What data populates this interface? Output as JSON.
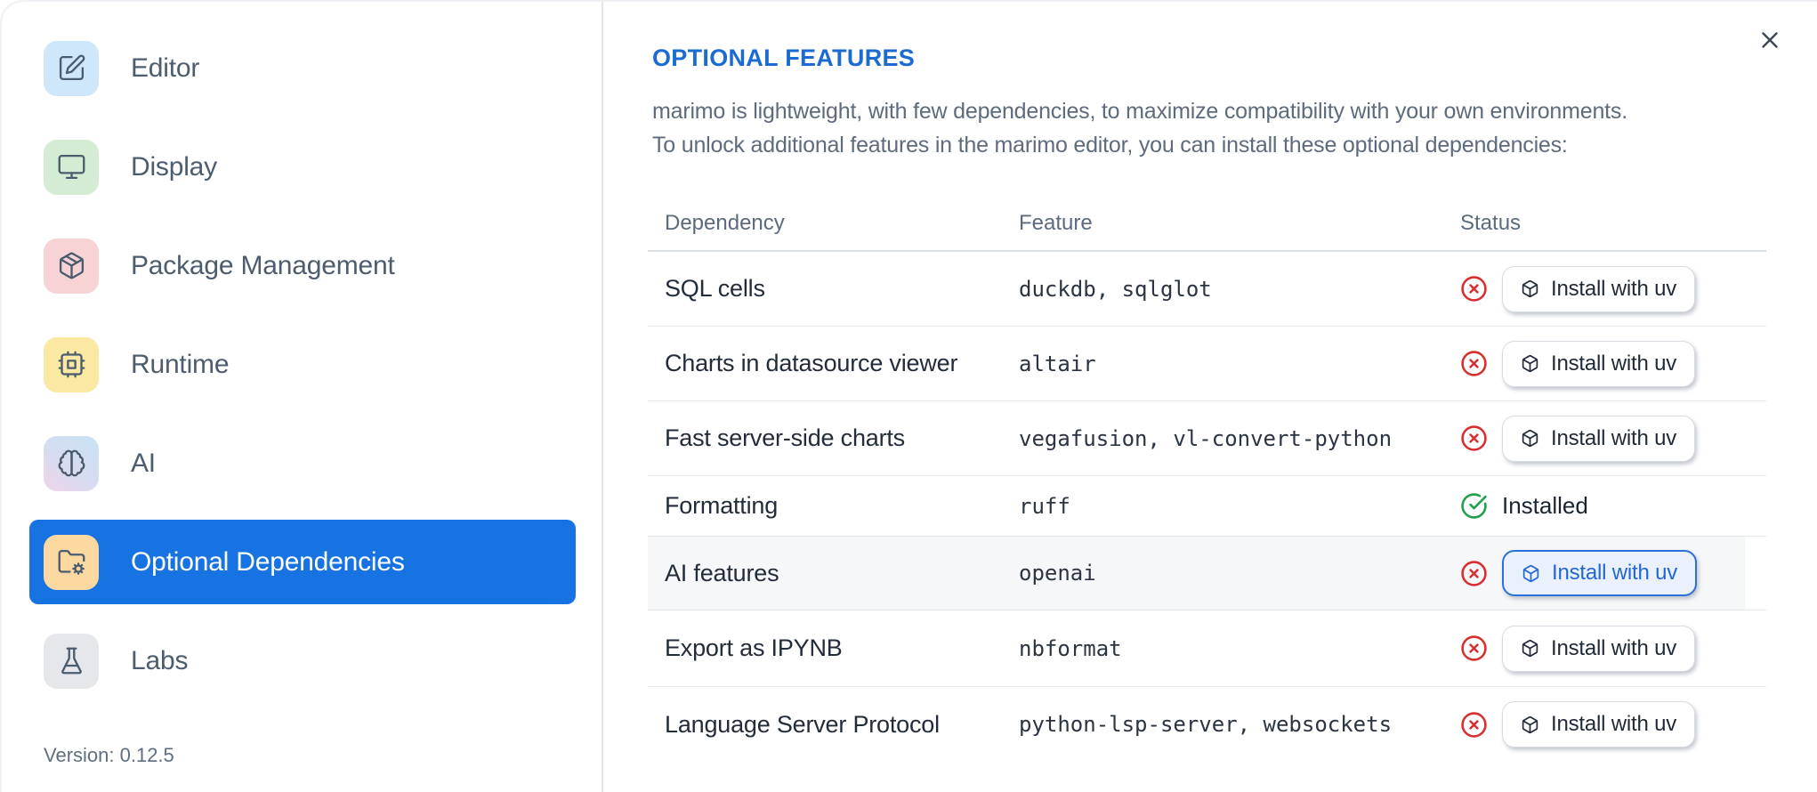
{
  "sidebar": {
    "items": [
      {
        "label": "Editor",
        "icon": "edit-icon",
        "icon_bg": "#cfe7fb",
        "selected": false
      },
      {
        "label": "Display",
        "icon": "monitor-icon",
        "icon_bg": "#d4ecd4",
        "selected": false
      },
      {
        "label": "Package Management",
        "icon": "package-icon",
        "icon_bg": "#f8d3d5",
        "selected": false
      },
      {
        "label": "Runtime",
        "icon": "cpu-icon",
        "icon_bg": "#fae8a3",
        "selected": false
      },
      {
        "label": "AI",
        "icon": "brain-icon",
        "icon_bg": "linear-gradient(#c7e3f2,#ecd6ea)",
        "selected": false
      },
      {
        "label": "Optional Dependencies",
        "icon": "folder-cog-icon",
        "icon_bg": "#fbd9a0",
        "selected": true
      },
      {
        "label": "Labs",
        "icon": "flask-icon",
        "icon_bg": "#e5e7ea",
        "selected": false
      }
    ],
    "version": "Version: 0.12.5"
  },
  "panel": {
    "title": "OPTIONAL FEATURES",
    "description_line1": "marimo is lightweight, with few dependencies, to maximize compatibility with your own environments.",
    "description_line2": "To unlock additional features in the marimo editor, you can install these optional dependencies:",
    "close_icon": "close-icon"
  },
  "table": {
    "headers": {
      "dependency": "Dependency",
      "feature": "Feature",
      "status": "Status"
    },
    "rows": [
      {
        "dependency": "SQL cells",
        "feature": "duckdb, sqlglot",
        "installed": false,
        "status_icon": "circle-x-icon",
        "button_label": "Install with uv"
      },
      {
        "dependency": "Charts in datasource viewer",
        "feature": "altair",
        "installed": false,
        "status_icon": "circle-x-icon",
        "button_label": "Install with uv"
      },
      {
        "dependency": "Fast server-side charts",
        "feature": "vegafusion, vl-convert-python",
        "installed": false,
        "status_icon": "circle-x-icon",
        "button_label": "Install with uv"
      },
      {
        "dependency": "Formatting",
        "feature": "ruff",
        "installed": true,
        "status_icon": "circle-check-icon",
        "status_label": "Installed"
      },
      {
        "dependency": "AI features",
        "feature": "openai",
        "installed": false,
        "status_icon": "circle-x-icon",
        "button_label": "Install with uv",
        "highlighted": true
      },
      {
        "dependency": "Export as IPYNB",
        "feature": "nbformat",
        "installed": false,
        "status_icon": "circle-x-icon",
        "button_label": "Install with uv"
      },
      {
        "dependency": "Language Server Protocol",
        "feature": "python-lsp-server, websockets",
        "installed": false,
        "status_icon": "circle-x-icon",
        "button_label": "Install with uv"
      }
    ],
    "button_icon": "box-icon"
  },
  "colors": {
    "accent_blue": "#1673e1",
    "title_blue": "#1c6bd2",
    "status_error_red": "#d63031",
    "status_success_green": "#1fa14b"
  }
}
